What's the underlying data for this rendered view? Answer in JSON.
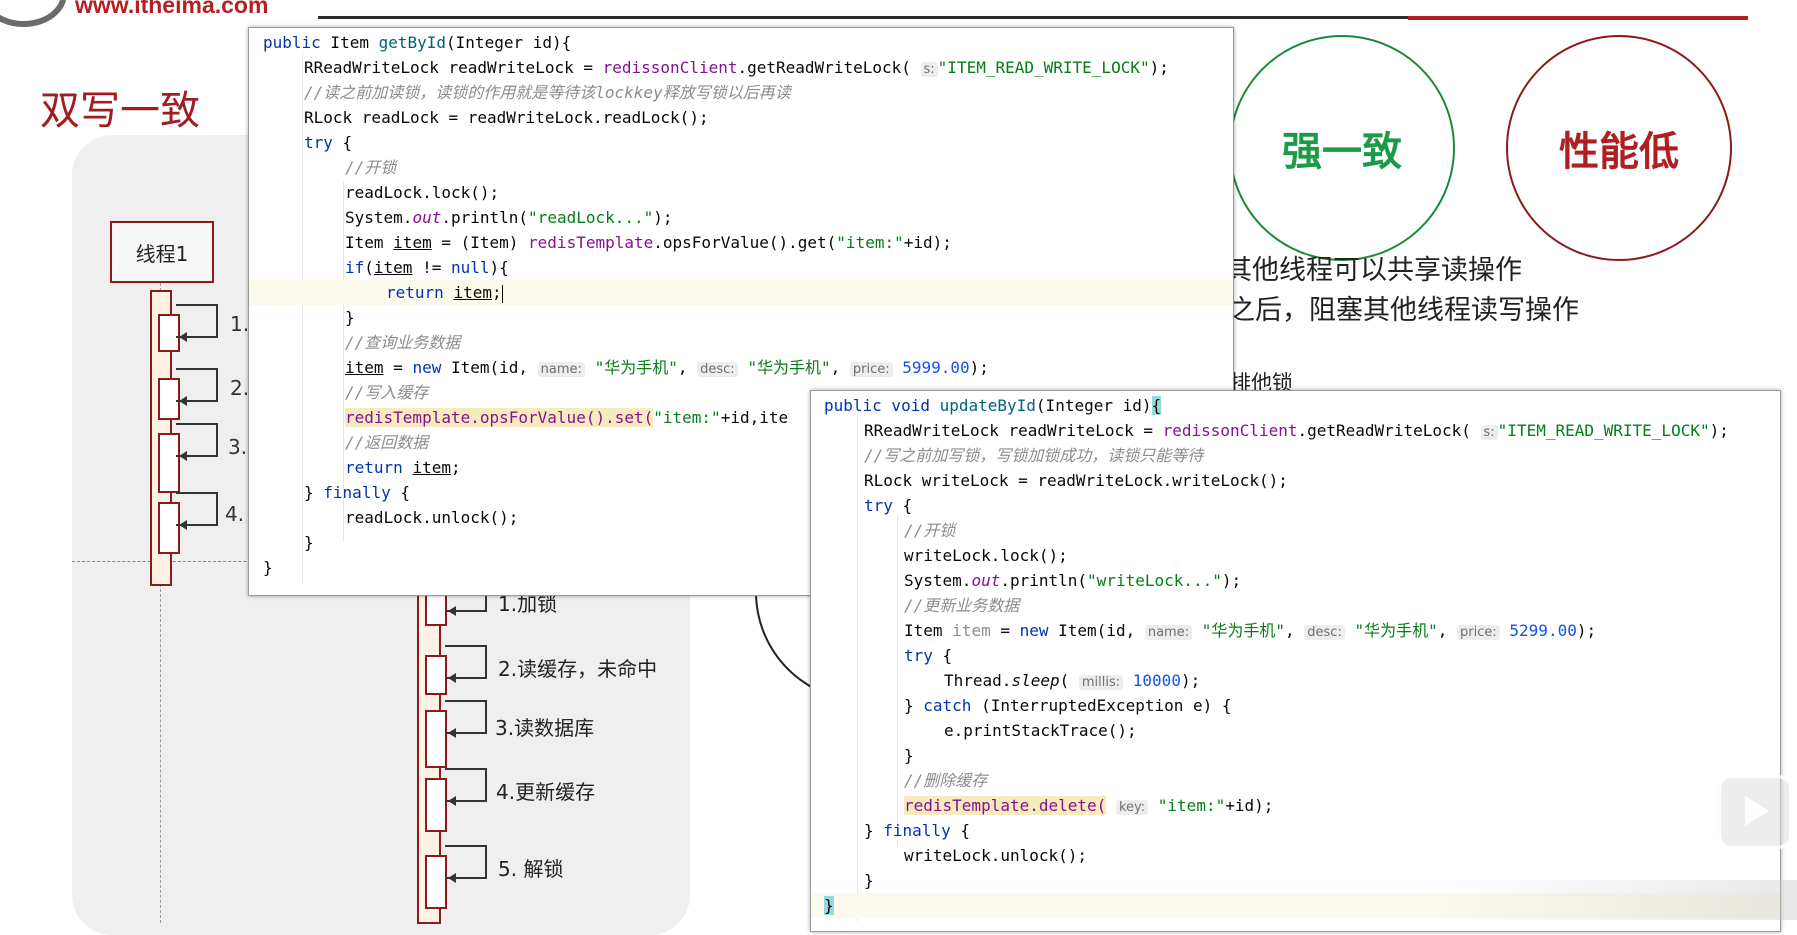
{
  "header": {
    "site_url": "www.itheima.com",
    "slide_title": "双写一致"
  },
  "diagram": {
    "thread1_label": "线程1",
    "thread1_steps": [
      "1.",
      "2.",
      "3.",
      "4."
    ],
    "thread2_steps": [
      "1.加锁",
      "2.读缓存，未命中",
      "3.读数据库",
      "4.更新缓存",
      "5. 解锁"
    ]
  },
  "badges": {
    "strong": "强一致",
    "low_perf": "性能低"
  },
  "notes": [
    "其他线程可以共享读操作",
    "之后，阻塞其他线程读写操作",
    "排他锁"
  ],
  "read_method": {
    "signature_kw": "public",
    "signature_rest": " Item ",
    "name": "getById",
    "params": "(Integer id){",
    "line2_a": "RReadWriteLock readWriteLock = ",
    "client": "redissonClient",
    "get_lock": ".getReadWriteLock(",
    "hint_s": "s:",
    "lock_key": "\"ITEM_READ_WRITE_LOCK\"",
    "close_paren": ");",
    "cmt_read_lock": "//读之前加读锁，读锁的作用就是等待该lockkey释放写锁以后再读",
    "rlock_line": "RLock readLock = readWriteLock.readLock();",
    "try_kw": "try",
    "open_brace": " {",
    "cmt_open": "//开锁",
    "lock_call": "readLock.lock();",
    "sysout_a": "System.",
    "sysout_out": "out",
    "sysout_b": ".println(",
    "sysout_str": "\"readLock...\"",
    "item_decl_a": "Item ",
    "item_var": "item",
    "item_decl_b": " = (Item) ",
    "redis_template": "redisTemplate",
    "get_call": ".opsForValue().get(",
    "item_key": "\"item:\"",
    "plus_id": "+id);",
    "if_kw": "if",
    "if_rest_a": "(",
    "if_rest_b": " != ",
    "null_kw": "null",
    "if_rest_c": "){",
    "return_kw": "return",
    "return_rest": ";",
    "close_brace": "}",
    "cmt_query": "//查询业务数据",
    "assign_a": " = ",
    "new_kw": "new",
    "new_item": " Item(id, ",
    "hint_name": "name:",
    "name_val": "\"华为手机\"",
    "hint_desc": "desc:",
    "desc_val": "\"华为手机\"",
    "hint_price": "price:",
    "price_val": "5999.00",
    "cmt_write_cache": "//写入缓存",
    "set_call": "redisTemplate.opsForValue().set(",
    "set_tail": "+id,ite",
    "cmt_return": "//返回数据",
    "finally_kw": "finally",
    "unlock_call": "readLock.unlock();"
  },
  "write_method": {
    "signature_kw": "public void ",
    "name": "updateById",
    "params": "(Integer id)",
    "line2_a": "RReadWriteLock readWriteLock = ",
    "client": "redissonClient",
    "get_lock": ".getReadWriteLock(",
    "hint_s": "s:",
    "lock_key": "\"ITEM_READ_WRITE_LOCK\"",
    "close_paren": ");",
    "cmt_write_lock": "//写之前加写锁，写锁加锁成功，读锁只能等待",
    "wlock_line": "RLock writeLock = readWriteLock.writeLock();",
    "try_kw": "try",
    "cmt_open": "//开锁",
    "lock_call": "writeLock.lock();",
    "sysout_a": "System.",
    "sysout_out": "out",
    "sysout_b": ".println(",
    "sysout_str": "\"writeLock...\"",
    "cmt_update": "//更新业务数据",
    "item_decl_a": "Item ",
    "item_var": "item",
    "assign_a": " = ",
    "new_kw": "new",
    "new_item": " Item(id, ",
    "hint_name": "name:",
    "name_val": "\"华为手机\"",
    "hint_desc": "desc:",
    "desc_val": "\"华为手机\"",
    "hint_price": "price:",
    "price_val": "5299.00",
    "close_paren2": ");",
    "sleep_a": "Thread.",
    "sleep_fn": "sleep",
    "sleep_b": "( ",
    "hint_millis": "millis:",
    "millis_val": "10000",
    "catch_kw": "catch",
    "catch_rest": " (InterruptedException e) {",
    "print_stack": "e.printStackTrace();",
    "cmt_delete": "//删除缓存",
    "delete_call": "redisTemplate.delete(",
    "hint_key": "key:",
    "item_key": "\"item:\"",
    "plus_id": "+id);",
    "finally_kw": "finally",
    "unlock_call": "writeLock.unlock();"
  },
  "colors": {
    "brand_red": "#b51f24",
    "strong_green": "#1d9a49",
    "lowperf_red": "#b01e22"
  }
}
